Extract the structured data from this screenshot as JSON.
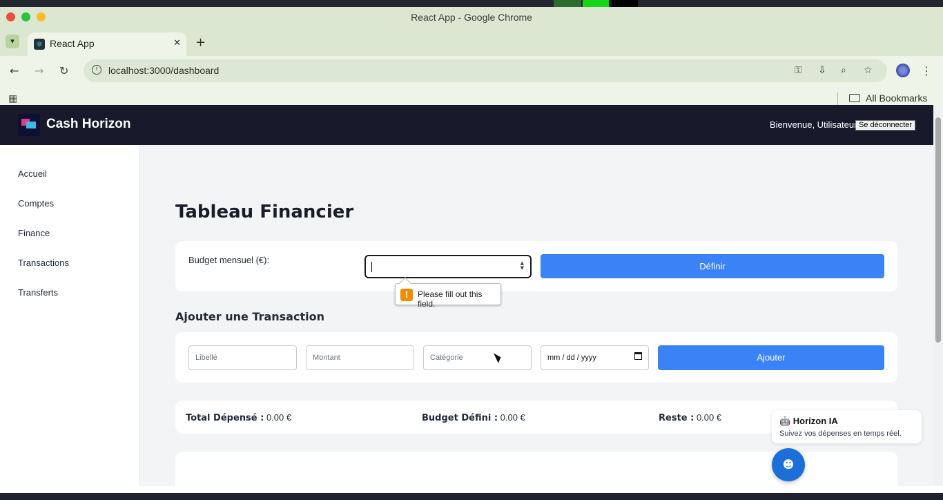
{
  "browser": {
    "window_title": "React App - Google Chrome",
    "tab_title": "React App",
    "url": "localhost:3000/dashboard",
    "bookmarks_label": "All Bookmarks"
  },
  "app": {
    "brand": "Cash Horizon",
    "welcome": "Bienvenue, Utilisateur",
    "logout_label": "Se déconnecter"
  },
  "sidebar": {
    "items": [
      {
        "label": "Accueil"
      },
      {
        "label": "Comptes"
      },
      {
        "label": "Finance"
      },
      {
        "label": "Transactions"
      },
      {
        "label": "Transferts"
      }
    ]
  },
  "main": {
    "title": "Tableau Financier",
    "budget": {
      "label": "Budget mensuel (€):",
      "value": "",
      "button_label": "Définir",
      "validation_message": "Please fill out this field."
    },
    "add_transaction": {
      "title": "Ajouter une Transaction",
      "libelle_placeholder": "Libellé",
      "montant_placeholder": "Montant",
      "categorie_placeholder": "Catégorie",
      "date_placeholder": "mm / dd / yyyy",
      "button_label": "Ajouter"
    },
    "summary": {
      "total_label": "Total Dépensé :",
      "total_value": "0.00 €",
      "budget_label": "Budget Défini :",
      "budget_value": "0.00 €",
      "reste_label": "Reste :",
      "reste_value": "0.00 €"
    }
  },
  "assistant": {
    "title": "🤖 Horizon IA",
    "subtitle": "Suivez vos dépenses en temps réel."
  },
  "colors": {
    "header_bg": "#181a2c",
    "primary": "#3b82f6",
    "fab": "#1d6fd8",
    "page_bg": "#f3f4f6",
    "warning": "#f08c00"
  },
  "icons": [
    "info-icon",
    "key-icon",
    "install-icon",
    "zoom-icon",
    "star-icon",
    "profile-icon",
    "kebab-menu-icon",
    "apps-grid-icon",
    "folder-icon",
    "warning-icon",
    "robot-icon",
    "calendar-icon"
  ]
}
